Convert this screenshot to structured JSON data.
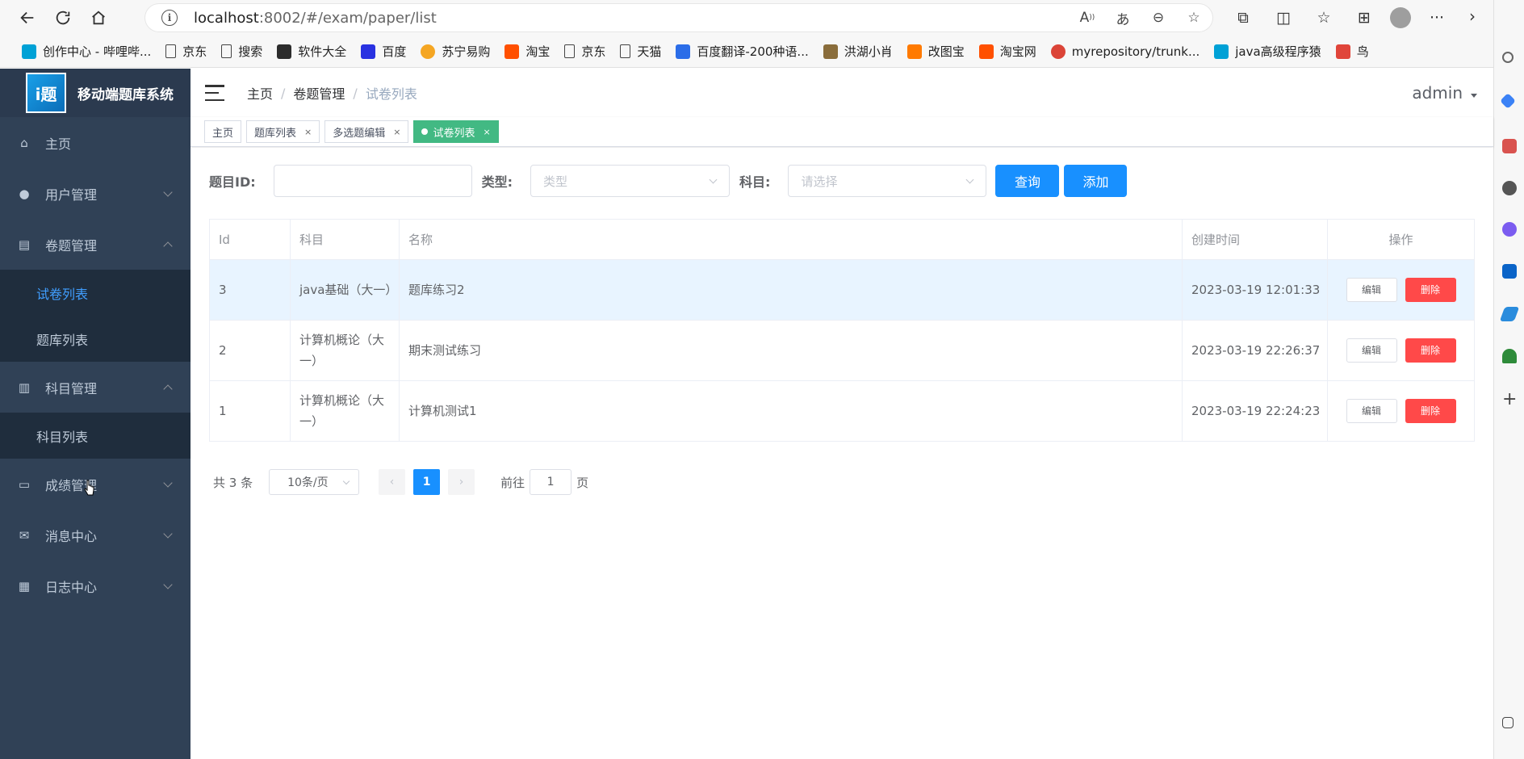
{
  "browser": {
    "url_host": "localhost",
    "url_path": ":8002/#/exam/paper/list",
    "bookmarks": [
      {
        "label": "创作中心 - 哔哩哔...",
        "icon": "bilibili-icon",
        "color": "#00a1d6"
      },
      {
        "label": "京东",
        "icon": "page-icon",
        "color": ""
      },
      {
        "label": "搜索",
        "icon": "page-icon",
        "color": ""
      },
      {
        "label": "软件大全",
        "icon": "software-icon",
        "color": "#2c2c2c"
      },
      {
        "label": "百度",
        "icon": "baidu-icon",
        "color": "#2932e1"
      },
      {
        "label": "苏宁易购",
        "icon": "suning-icon",
        "color": "#f5a623"
      },
      {
        "label": "淘宝",
        "icon": "taobao-icon",
        "color": "#ff5000"
      },
      {
        "label": "京东",
        "icon": "page-icon",
        "color": ""
      },
      {
        "label": "天猫",
        "icon": "page-icon",
        "color": ""
      },
      {
        "label": "百度翻译-200种语...",
        "icon": "translate-icon",
        "color": "#2b6de8"
      },
      {
        "label": "洪湖小肖",
        "icon": "bird-icon",
        "color": "#8a6d3b"
      },
      {
        "label": "改图宝",
        "icon": "gaitubao-icon",
        "color": "#ff7a00"
      },
      {
        "label": "淘宝网",
        "icon": "taobao-icon",
        "color": "#ff5000"
      },
      {
        "label": "myrepository/trunk...",
        "icon": "chrome-icon",
        "color": "#db4437"
      },
      {
        "label": "java高级程序猿",
        "icon": "bilibili-icon",
        "color": "#00a1d6"
      },
      {
        "label": "鸟",
        "icon": "feishu-icon",
        "color": "#e0453a"
      }
    ]
  },
  "app": {
    "title": "移动端题库系统",
    "logo_text": "i题",
    "user": "admin",
    "accent": "#1890ff",
    "sidebar_bg": "#304156"
  },
  "menu": {
    "home": "主页",
    "user_mgmt": "用户管理",
    "paper_mgmt": "卷题管理",
    "paper_list": "试卷列表",
    "question_list": "题库列表",
    "subject_mgmt": "科目管理",
    "subject_list": "科目列表",
    "score_mgmt": "成绩管理",
    "message_center": "消息中心",
    "log_center": "日志中心"
  },
  "breadcrumb": [
    "主页",
    "卷题管理",
    "试卷列表"
  ],
  "tags": [
    {
      "label": "主页",
      "closable": false,
      "active": false
    },
    {
      "label": "题库列表",
      "closable": true,
      "active": false
    },
    {
      "label": "多选题编辑",
      "closable": true,
      "active": false
    },
    {
      "label": "试卷列表",
      "closable": true,
      "active": true
    }
  ],
  "filter": {
    "id_label": "题目ID:",
    "id_value": "",
    "type_label": "类型:",
    "type_placeholder": "类型",
    "subject_label": "科目:",
    "subject_placeholder": "请选择",
    "query_button": "查询",
    "add_button": "添加"
  },
  "table": {
    "columns": [
      "Id",
      "科目",
      "名称",
      "创建时间",
      "操作"
    ],
    "edit_label": "编辑",
    "delete_label": "删除",
    "rows": [
      {
        "id": "3",
        "subject": "java基础（大一）",
        "name": "题库练习2",
        "created": "2023-03-19 12:01:33",
        "highlight": true
      },
      {
        "id": "2",
        "subject": "计算机概论（大一）",
        "name": "期末测试练习",
        "created": "2023-03-19 22:26:37",
        "highlight": false
      },
      {
        "id": "1",
        "subject": "计算机概论（大一）",
        "name": "计算机测试1",
        "created": "2023-03-19 22:24:23",
        "highlight": false
      }
    ]
  },
  "pagination": {
    "total_text": "共 3 条",
    "page_size": "10条/页",
    "current_page": "1",
    "goto_label": "前往",
    "goto_value": "1",
    "page_suffix": "页"
  }
}
